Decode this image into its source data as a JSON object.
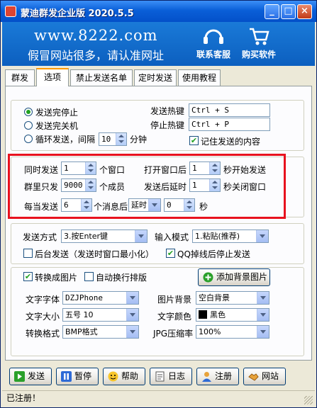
{
  "window": {
    "title": "蒙迪群发企业版 2020.5.5"
  },
  "banner": {
    "site": "www.8222.com",
    "slogan": "假冒网站很多，请认准网址",
    "nav": [
      {
        "label": "联系客服",
        "icon": "headset-icon"
      },
      {
        "label": "购买软件",
        "icon": "cart-icon"
      }
    ]
  },
  "tabs": [
    "群发",
    "选项",
    "禁止发送名单",
    "定时发送",
    "使用教程"
  ],
  "active_tab": "选项",
  "send_mode": {
    "options": [
      "发送完停止",
      "发送完关机",
      "循环发送，间隔"
    ],
    "selected": 0,
    "interval": "10",
    "interval_unit": "分钟",
    "send_hotkey_label": "发送热键",
    "send_hotkey": "Ctrl + S",
    "stop_hotkey_label": "停止热键",
    "stop_hotkey": "Ctrl + P",
    "remember_label": "记住发送的内容",
    "remember_checked": true
  },
  "timing": {
    "sync_label": "同时发送",
    "sync_value": "1",
    "sync_unit": "个窗口",
    "open_label": "打开窗口后",
    "open_value": "1",
    "open_unit": "秒开始发送",
    "group_label": "群里只发",
    "group_value": "9000",
    "group_unit": "个成员",
    "close_label": "发送后延时",
    "close_value": "1",
    "close_unit": "秒关闭窗口",
    "each_label": "每当发送",
    "each_value": "6",
    "each_unit": "个消息后",
    "delay_select": "延时",
    "delay_value": "0",
    "delay_unit": "秒"
  },
  "method": {
    "method_label": "发送方式",
    "method_value": "3.按Enter键",
    "input_label": "输入模式",
    "input_value": "1.粘贴(推荐)",
    "background_label": "后台发送（发送时窗口最小化）",
    "background_checked": false,
    "stop_drop_label": "QQ掉线后停止发送",
    "stop_drop_checked": true
  },
  "image": {
    "convert_label": "转换成图片",
    "convert_checked": true,
    "autowrap_label": "自动换行排版",
    "autowrap_checked": false,
    "add_bg_button": "添加背景图片",
    "font_label": "文字字体",
    "font_value": "DZJPhone",
    "bg_label": "图片背景",
    "bg_value": "空白背景",
    "size_label": "文字大小",
    "size_value": "五号 10",
    "color_label": "文字颜色",
    "color_value": "黑色",
    "color_swatch": "#000000",
    "format_label": "转换格式",
    "format_value": "BMP格式",
    "jpg_label": "JPG压缩率",
    "jpg_value": "100%"
  },
  "buttons": [
    {
      "label": "发送",
      "icon": "play-icon"
    },
    {
      "label": "暂停",
      "icon": "pause-icon"
    },
    {
      "label": "帮助",
      "icon": "smiley-icon"
    },
    {
      "label": "日志",
      "icon": "document-icon"
    },
    {
      "label": "注册",
      "icon": "user-icon"
    },
    {
      "label": "网站",
      "icon": "handshake-icon"
    }
  ],
  "status": "已注册！",
  "colors": {
    "titlebar": "#0a5fd8",
    "banner": "#0c5fbf",
    "highlight_border": "#e8121e",
    "radio_dot": "#21a121"
  }
}
